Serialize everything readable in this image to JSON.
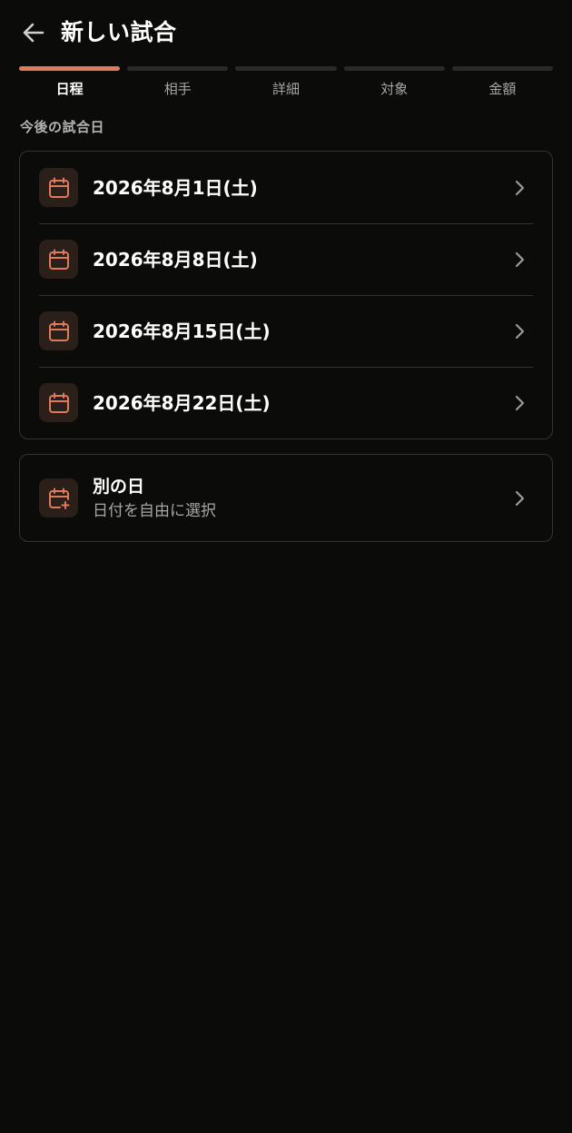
{
  "header": {
    "title": "新しい試合",
    "back_icon": "arrow-left-icon"
  },
  "steps": [
    {
      "label": "日程",
      "active": true
    },
    {
      "label": "相手",
      "active": false
    },
    {
      "label": "詳細",
      "active": false
    },
    {
      "label": "対象",
      "active": false
    },
    {
      "label": "金額",
      "active": false
    }
  ],
  "section": {
    "label": "今後の試合日"
  },
  "dates": [
    {
      "label": "2026年8月1日(土)",
      "icon": "calendar-icon"
    },
    {
      "label": "2026年8月8日(土)",
      "icon": "calendar-icon"
    },
    {
      "label": "2026年8月15日(土)",
      "icon": "calendar-icon"
    },
    {
      "label": "2026年8月22日(土)",
      "icon": "calendar-icon"
    }
  ],
  "other_day": {
    "title": "別の日",
    "subtitle": "日付を自由に選択",
    "icon": "calendar-plus-icon"
  },
  "colors": {
    "background": "#0b0b0a",
    "accent": "#e07a5c",
    "icon_bg": "#2b1f1a",
    "border": "#333333",
    "muted_text": "#a6a6a6"
  }
}
